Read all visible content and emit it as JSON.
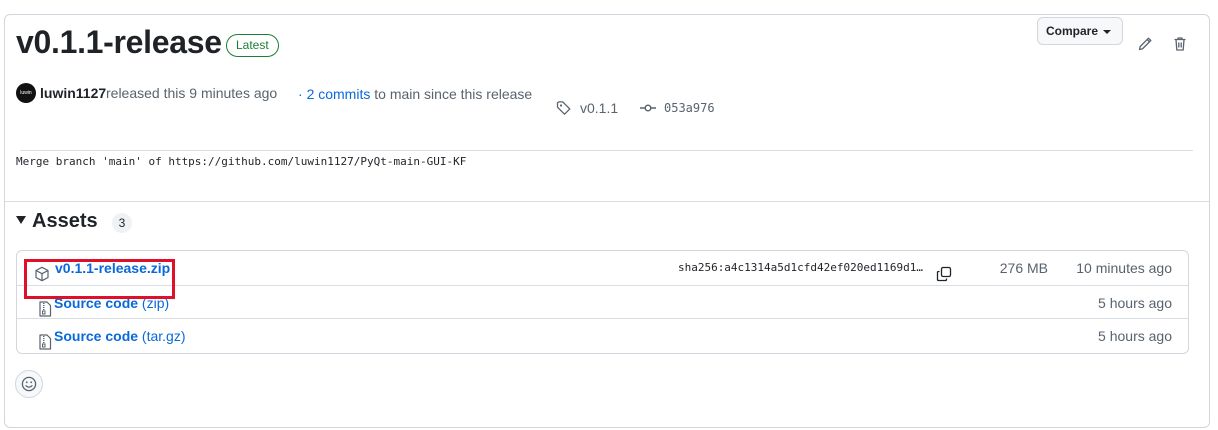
{
  "release": {
    "title": "v0.1.1-release",
    "badge": "Latest",
    "author": "luwin1127",
    "avatar_text": "luwin",
    "released_text": "released this 9 minutes ago",
    "commits_prefix": "·",
    "commits_link": "2 commits",
    "commits_suffix": "to main since this release",
    "tag": "v0.1.1",
    "commit": "053a976",
    "commit_message": "Merge branch 'main' of https://github.com/luwin1127/PyQt-main-GUI-KF"
  },
  "toolbar": {
    "compare_label": "Compare",
    "edit_icon": "pencil-icon",
    "delete_icon": "trash-icon"
  },
  "assets": {
    "heading": "Assets",
    "count": "3",
    "items": [
      {
        "name": "v0.1.1-release.zip",
        "paren": "",
        "icon": "package-icon",
        "sha": "sha256:a4c1314a5d1cfd42ef020ed1169d1…",
        "size": "276 MB",
        "date": "10 minutes ago"
      },
      {
        "name": "Source code",
        "paren": "(zip)",
        "icon": "file-zip-icon",
        "sha": "",
        "size": "",
        "date": "5 hours ago"
      },
      {
        "name": "Source code",
        "paren": "(tar.gz)",
        "icon": "file-zip-icon",
        "sha": "",
        "size": "",
        "date": "5 hours ago"
      }
    ]
  },
  "colors": {
    "link": "#0969da",
    "latest": "#1a7f37",
    "highlight": "#e0102a"
  }
}
